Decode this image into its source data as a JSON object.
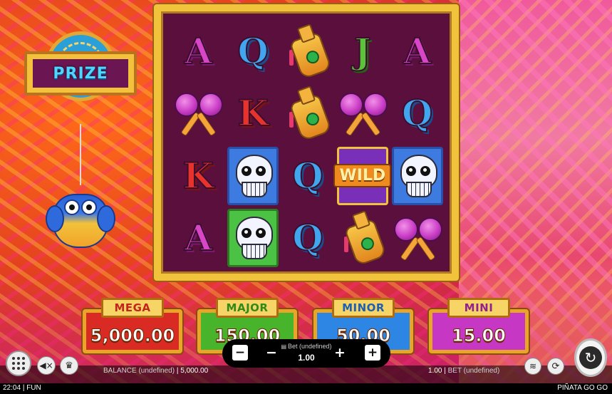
{
  "prize": {
    "label": "PRIZE"
  },
  "reels": [
    [
      {
        "type": "letter",
        "text": "A",
        "cls": "A"
      },
      {
        "type": "letter",
        "text": "Q",
        "cls": "Q"
      },
      {
        "type": "bottle"
      },
      {
        "type": "letter",
        "text": "J",
        "cls": "J"
      },
      {
        "type": "letter",
        "text": "A",
        "cls": "A"
      }
    ],
    [
      {
        "type": "maracas"
      },
      {
        "type": "letter",
        "text": "K",
        "cls": "K"
      },
      {
        "type": "bottle"
      },
      {
        "type": "maracas"
      },
      {
        "type": "letter",
        "text": "Q",
        "cls": "Q"
      }
    ],
    [
      {
        "type": "letter",
        "text": "K",
        "cls": "K"
      },
      {
        "type": "skull",
        "color": "blue"
      },
      {
        "type": "letter",
        "text": "Q",
        "cls": "Q"
      },
      {
        "type": "wild",
        "text": "WILD"
      },
      {
        "type": "skull",
        "color": "blue"
      }
    ],
    [
      {
        "type": "letter",
        "text": "A",
        "cls": "A"
      },
      {
        "type": "skull",
        "color": "green"
      },
      {
        "type": "letter",
        "text": "Q",
        "cls": "Q"
      },
      {
        "type": "bottle"
      },
      {
        "type": "maracas"
      }
    ]
  ],
  "jackpots": {
    "mega": {
      "label": "MEGA",
      "value": "5,000.00"
    },
    "major": {
      "label": "MAJOR",
      "value": "150.00"
    },
    "minor": {
      "label": "MINOR",
      "value": "50.00"
    },
    "mini": {
      "label": "MINI",
      "value": "15.00"
    }
  },
  "hud": {
    "balance_label": "BALANCE (undefined)",
    "balance_value": "5,000.00",
    "bet_label": "Bet (undefined)",
    "bet_value": "1.00",
    "right_bet_value": "1.00",
    "right_bet_label": "BET (undefined)",
    "minus_sq": "−",
    "minus": "−",
    "plus": "+",
    "plus_sq": "+"
  },
  "status": {
    "time": "22:04",
    "mode": "FUN",
    "game_title": "PIÑATA GO GO"
  },
  "icons": {
    "menu": "menu-grid-icon",
    "sound": "sound-muted-icon",
    "trophy": "trophy-icon",
    "coins": "coin-stack-icon",
    "autoplay": "autoplay-icon",
    "spin": "spin-arrows-icon"
  }
}
